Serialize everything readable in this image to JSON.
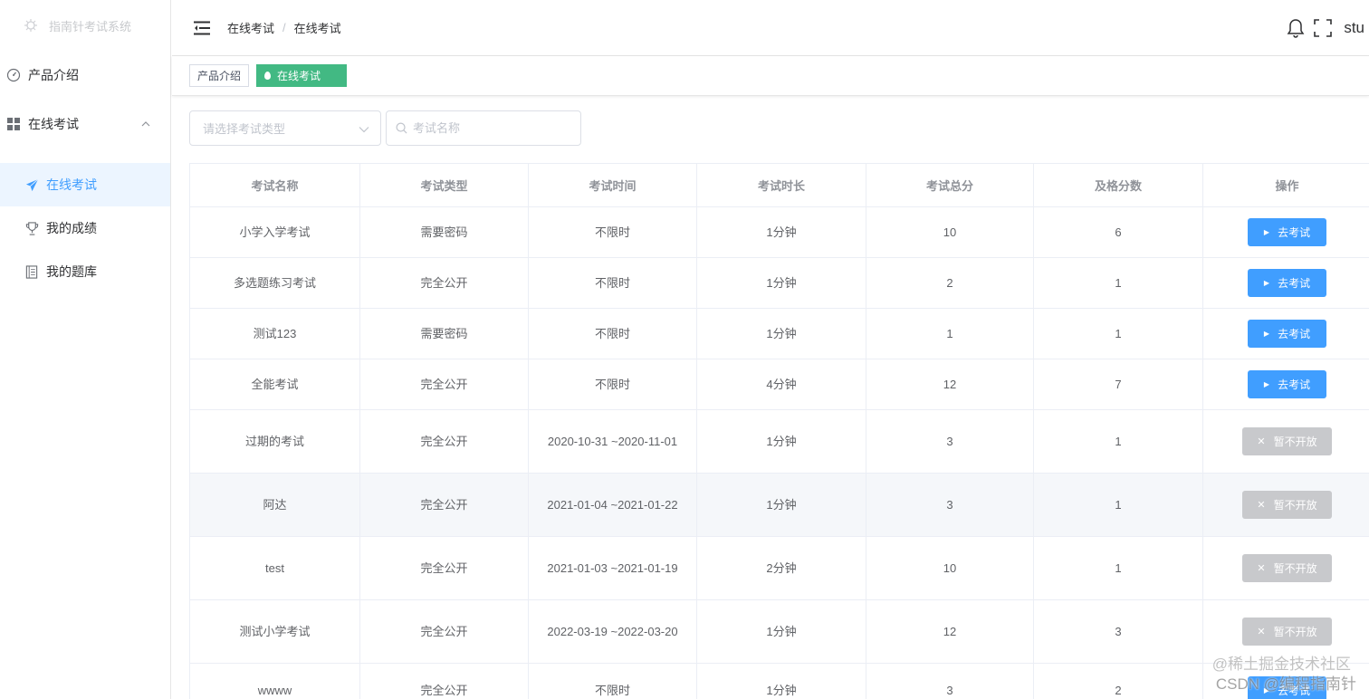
{
  "sidebar": {
    "logo_text": "指南针考试系统",
    "items": [
      {
        "label": "产品介绍",
        "icon": "dashboard-icon"
      },
      {
        "label": "在线考试",
        "icon": "grid-icon",
        "expanded": true
      }
    ],
    "sub_items": [
      {
        "label": "在线考试",
        "icon": "paper-plane-icon",
        "active": true
      },
      {
        "label": "我的成绩",
        "icon": "trophy-icon"
      },
      {
        "label": "我的题库",
        "icon": "book-icon"
      }
    ]
  },
  "header": {
    "breadcrumb": [
      "在线考试",
      "在线考试"
    ],
    "breadcrumb_sep": "/",
    "username": "stu"
  },
  "tags": [
    {
      "label": "产品介绍",
      "active": false
    },
    {
      "label": "在线考试",
      "active": true
    }
  ],
  "filters": {
    "type_placeholder": "请选择考试类型",
    "name_placeholder": "考试名称"
  },
  "table": {
    "columns": [
      "考试名称",
      "考试类型",
      "考试时间",
      "考试时长",
      "考试总分",
      "及格分数",
      "操作"
    ],
    "rows": [
      {
        "name": "小学入学考试",
        "type": "需要密码",
        "time": "不限时",
        "duration": "1分钟",
        "total": "10",
        "pass": "6",
        "action": "去考试",
        "enabled": true
      },
      {
        "name": "多选题练习考试",
        "type": "完全公开",
        "time": "不限时",
        "duration": "1分钟",
        "total": "2",
        "pass": "1",
        "action": "去考试",
        "enabled": true
      },
      {
        "name": "测试123",
        "type": "需要密码",
        "time": "不限时",
        "duration": "1分钟",
        "total": "1",
        "pass": "1",
        "action": "去考试",
        "enabled": true
      },
      {
        "name": "全能考试",
        "type": "完全公开",
        "time": "不限时",
        "duration": "4分钟",
        "total": "12",
        "pass": "7",
        "action": "去考试",
        "enabled": true
      },
      {
        "name": "过期的考试",
        "type": "完全公开",
        "time": "2020-10-31 ~2020-11-01",
        "duration": "1分钟",
        "total": "3",
        "pass": "1",
        "action": "暂不开放",
        "enabled": false
      },
      {
        "name": "阿达",
        "type": "完全公开",
        "time": "2021-01-04 ~2021-01-22",
        "duration": "1分钟",
        "total": "3",
        "pass": "1",
        "action": "暂不开放",
        "enabled": false,
        "hover": true
      },
      {
        "name": "test",
        "type": "完全公开",
        "time": "2021-01-03 ~2021-01-19",
        "duration": "2分钟",
        "total": "10",
        "pass": "1",
        "action": "暂不开放",
        "enabled": false
      },
      {
        "name": "测试小学考试",
        "type": "完全公开",
        "time": "2022-03-19 ~2022-03-20",
        "duration": "1分钟",
        "total": "12",
        "pass": "3",
        "action": "暂不开放",
        "enabled": false
      },
      {
        "name": "wwww",
        "type": "完全公开",
        "time": "不限时",
        "duration": "1分钟",
        "total": "3",
        "pass": "2",
        "action": "去考试",
        "enabled": true
      }
    ]
  },
  "watermark": {
    "line1": "@稀土掘金技术社区",
    "line2": "CSDN @编程指南针"
  },
  "colors": {
    "primary": "#409eff",
    "tag_active": "#42b983",
    "disabled": "#c8c9cc"
  }
}
